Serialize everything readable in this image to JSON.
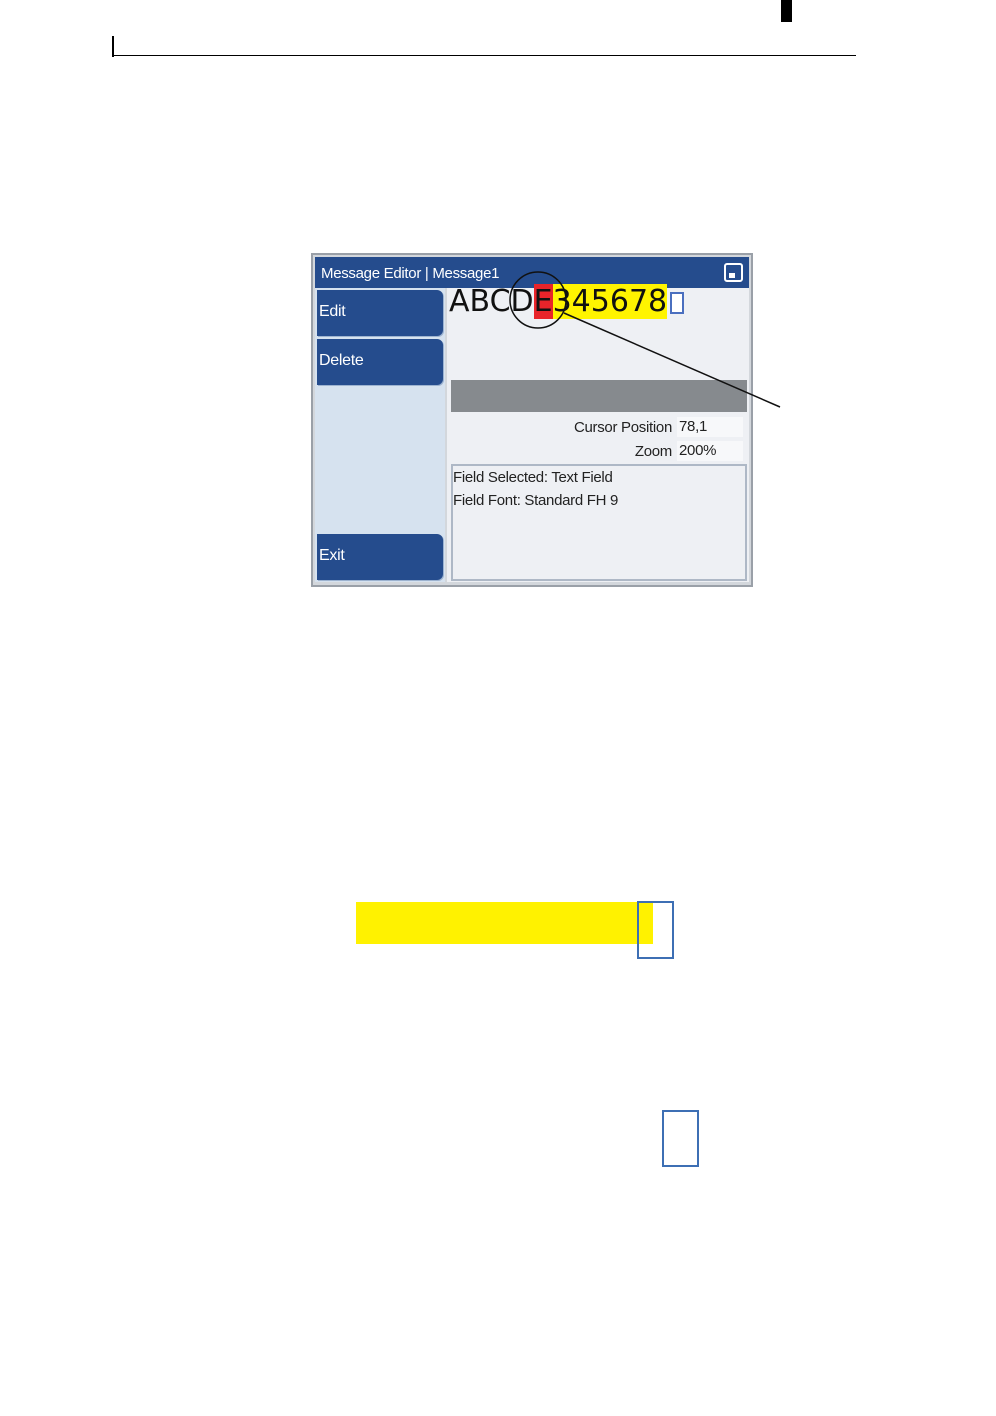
{
  "window": {
    "title": "Message Editor | Message1",
    "icon": "window-minimize-icon"
  },
  "sidebar": {
    "buttons": [
      {
        "label": "Edit"
      },
      {
        "label": "Delete"
      },
      {
        "label": "Exit"
      }
    ]
  },
  "message": {
    "segments": [
      {
        "text": "ABCD",
        "style": "plain"
      },
      {
        "text": "E",
        "style": "red"
      },
      {
        "text": "345678",
        "style": "yellow"
      }
    ]
  },
  "info": {
    "cursor_position_label": "Cursor Position",
    "cursor_position_value": "78,1",
    "zoom_label": "Zoom",
    "zoom_value": "200%"
  },
  "field_details": {
    "line1": "Field Selected: Text Field",
    "line2": "Field Font: Standard FH 9"
  },
  "colors": {
    "titlebar": "#254c8d",
    "highlight_red": "#e8242a",
    "highlight_yellow": "#fff400",
    "cursor_outline": "#3d6fb4"
  }
}
